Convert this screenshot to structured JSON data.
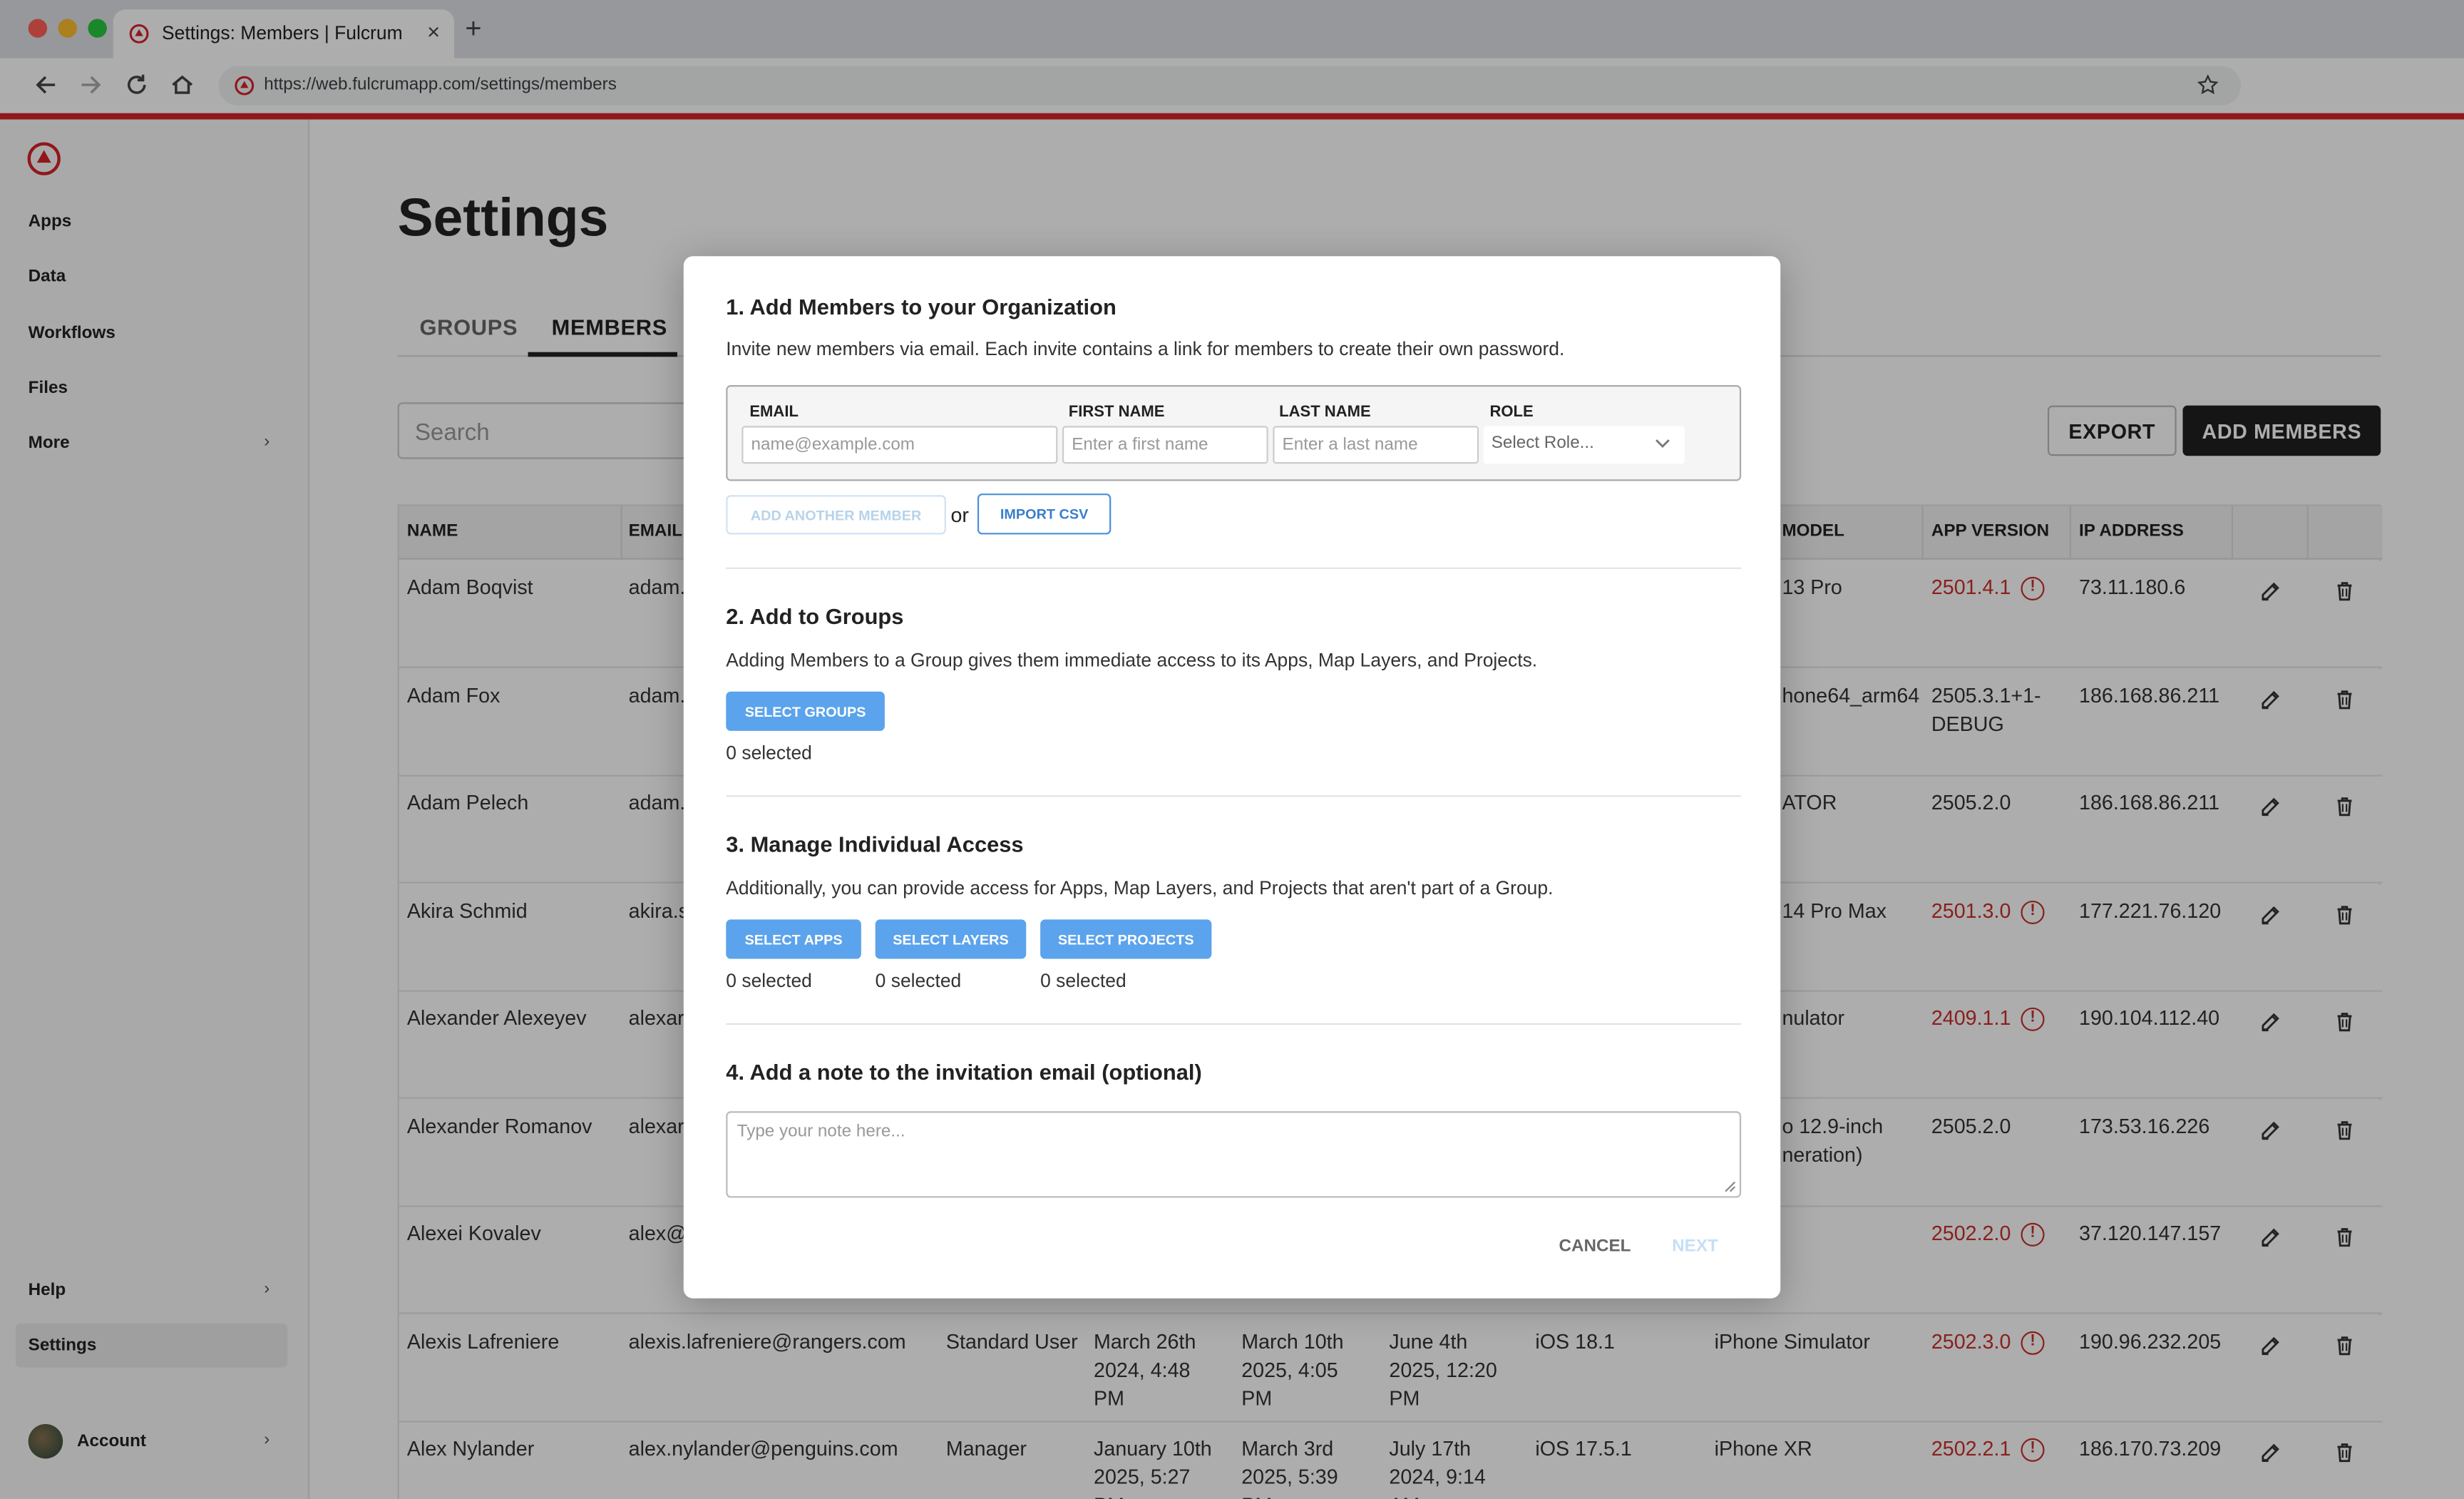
{
  "browser": {
    "tab_title": "Settings: Members | Fulcrum",
    "tab_close": "×",
    "new_tab": "+",
    "url": "https://web.fulcrumapp.com/settings/members"
  },
  "sidebar": {
    "items": [
      {
        "label": "Apps"
      },
      {
        "label": "Data"
      },
      {
        "label": "Workflows"
      },
      {
        "label": "Files"
      },
      {
        "label": "More",
        "chevron": "›"
      }
    ],
    "help": {
      "label": "Help",
      "chevron": "›"
    },
    "settings": {
      "label": "Settings"
    },
    "account": {
      "label": "Account",
      "chevron": "›"
    }
  },
  "page": {
    "title": "Settings",
    "tabs": [
      "GROUPS",
      "MEMBERS"
    ],
    "search_placeholder": "Search",
    "export_label": "EXPORT",
    "add_members_label": "ADD MEMBERS"
  },
  "table": {
    "headers": {
      "name": "NAME",
      "email": "EMAIL",
      "model": "MODEL",
      "app_version": "APP VERSION",
      "ip": "IP ADDRESS"
    },
    "rows": [
      {
        "name": "Adam Boqvist",
        "email": "adam.",
        "model": "13 Pro",
        "app": "2501.4.1",
        "app_warn": true,
        "ip": "73.11.180.6"
      },
      {
        "name": "Adam Fox",
        "email": "adam.",
        "model": "hone64_arm64",
        "app": "2505.3.1+1-",
        "app2": "DEBUG",
        "app_warn": false,
        "ip": "186.168.86.211"
      },
      {
        "name": "Adam Pelech",
        "email": "adam.",
        "model": "ATOR",
        "app": "2505.2.0",
        "app_warn": false,
        "ip": "186.168.86.211"
      },
      {
        "name": "Akira Schmid",
        "email": "akira.s",
        "model": "14 Pro Max",
        "app": "2501.3.0",
        "app_warn": true,
        "ip": "177.221.76.120"
      },
      {
        "name": "Alexander Alexeyev",
        "email": "alexar",
        "model": "nulator",
        "app": "2409.1.1",
        "app_warn": true,
        "ip": "190.104.112.40"
      },
      {
        "name": "Alexander Romanov",
        "email": "alexar",
        "model": "o 12.9-inch",
        "model2": "neration)",
        "app": "2505.2.0",
        "app_warn": false,
        "ip": "173.53.16.226"
      },
      {
        "name": "Alexei Kovalev",
        "email": "alex@",
        "model": "",
        "app": "2502.2.0",
        "app_warn": true,
        "ip": "37.120.147.157"
      },
      {
        "name": "Alexis Lafreniere",
        "email": "alexis.lafreniere@rangers.com",
        "role": "Standard User",
        "c1": [
          "March 26th",
          "2024, 4:48",
          "PM"
        ],
        "c2": [
          "March 10th",
          "2025, 4:05",
          "PM"
        ],
        "c3": [
          "June 4th",
          "2025, 12:20",
          "PM"
        ],
        "os": "iOS 18.1",
        "model": "iPhone Simulator",
        "app": "2502.3.0",
        "app_warn": true,
        "ip": "190.96.232.205"
      },
      {
        "name": "Alex Nylander",
        "email": "alex.nylander@penguins.com",
        "role": "Manager",
        "c1": [
          "January 10th",
          "2025, 5:27",
          "PM"
        ],
        "c2": [
          "March 3rd",
          "2025, 5:39",
          "PM"
        ],
        "c3": [
          "July 17th",
          "2024, 9:14",
          "AM"
        ],
        "os": "iOS 17.5.1",
        "model": "iPhone XR",
        "app": "2502.2.1",
        "app_warn": true,
        "ip": "186.170.73.209"
      }
    ],
    "warn_glyph": "!"
  },
  "modal": {
    "s1_title": "1. Add Members to your Organization",
    "s1_desc": "Invite new members via email. Each invite contains a link for members to create their own password.",
    "email_label": "EMAIL",
    "email_placeholder": "name@example.com",
    "first_label": "FIRST NAME",
    "first_placeholder": "Enter a first name",
    "last_label": "LAST NAME",
    "last_placeholder": "Enter a last name",
    "role_label": "ROLE",
    "role_placeholder": "Select Role...",
    "add_another": "ADD ANOTHER MEMBER",
    "or": "or",
    "import_csv": "IMPORT CSV",
    "s2_title": "2. Add to Groups",
    "s2_desc": "Adding Members to a Group gives them immediate access to its Apps, Map Layers, and Projects.",
    "select_groups": "SELECT GROUPS",
    "groups_count": "0 selected",
    "s3_title": "3. Manage Individual Access",
    "s3_desc": "Additionally, you can provide access for Apps, Map Layers, and Projects that aren't part of a Group.",
    "select_apps": "SELECT APPS",
    "select_layers": "SELECT LAYERS",
    "select_projects": "SELECT PROJECTS",
    "apps_count": "0 selected",
    "layers_count": "0 selected",
    "projects_count": "0 selected",
    "s4_title": "4. Add a note to the invitation email (optional)",
    "note_placeholder": "Type your note here...",
    "cancel": "CANCEL",
    "next": "NEXT"
  },
  "colors": {
    "brand_red": "#d6232a",
    "primary_blue": "#5ba3ec",
    "warning_red": "#c9302c"
  }
}
